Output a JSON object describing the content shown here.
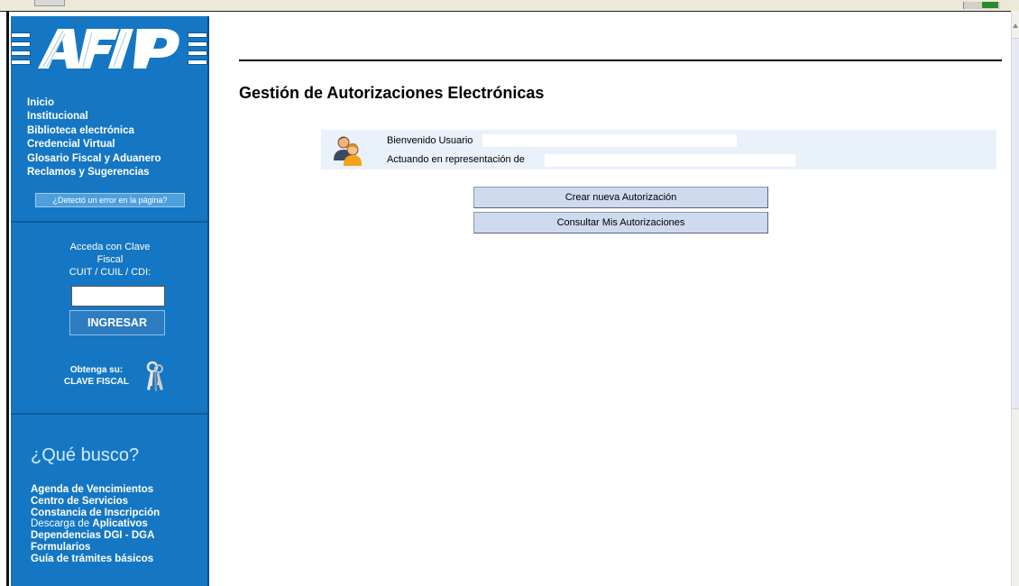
{
  "sidebar": {
    "logo_text": "AFIP",
    "nav": [
      "Inicio",
      "Institucional",
      "Biblioteca electrónica",
      "Credencial Virtual",
      "Glosario Fiscal y Aduanero",
      "Reclamos y Sugerencias"
    ],
    "error_link": "¿Detectó un error en la página?",
    "login": {
      "line1": "Acceda con Clave",
      "line2": "Fiscal",
      "line3": "CUIT / CUIL / CDI:",
      "cuit_value": "",
      "button": "INGRESAR"
    },
    "obtenga": {
      "line1": "Obtenga su:",
      "line2": "CLAVE FISCAL"
    },
    "que_busco": "¿Qué busco?",
    "links": [
      {
        "text": "Agenda de Vencimientos"
      },
      {
        "text": "Centro de Servicios"
      },
      {
        "text": "Constancia de Inscripción"
      },
      {
        "prefix": "Descarga de ",
        "text": "Aplicativos"
      },
      {
        "text": "Dependencias DGI - DGA"
      },
      {
        "text": "Formularios"
      },
      {
        "text": "Guía de trámites básicos"
      }
    ]
  },
  "main": {
    "title": "Gestión de Autorizaciones Electrónicas",
    "welcome_label": "Bienvenido Usuario",
    "representation_label": "Actuando en representación de",
    "buttons": {
      "create": "Crear nueva Autorización",
      "consult": "Consultar Mis Autorizaciones"
    }
  },
  "colors": {
    "sidebar_bg": "#1577c3",
    "que_busco": "#d2ecff",
    "welcome_bg": "#e9f1fb",
    "button_bg": "#cfdaee"
  }
}
